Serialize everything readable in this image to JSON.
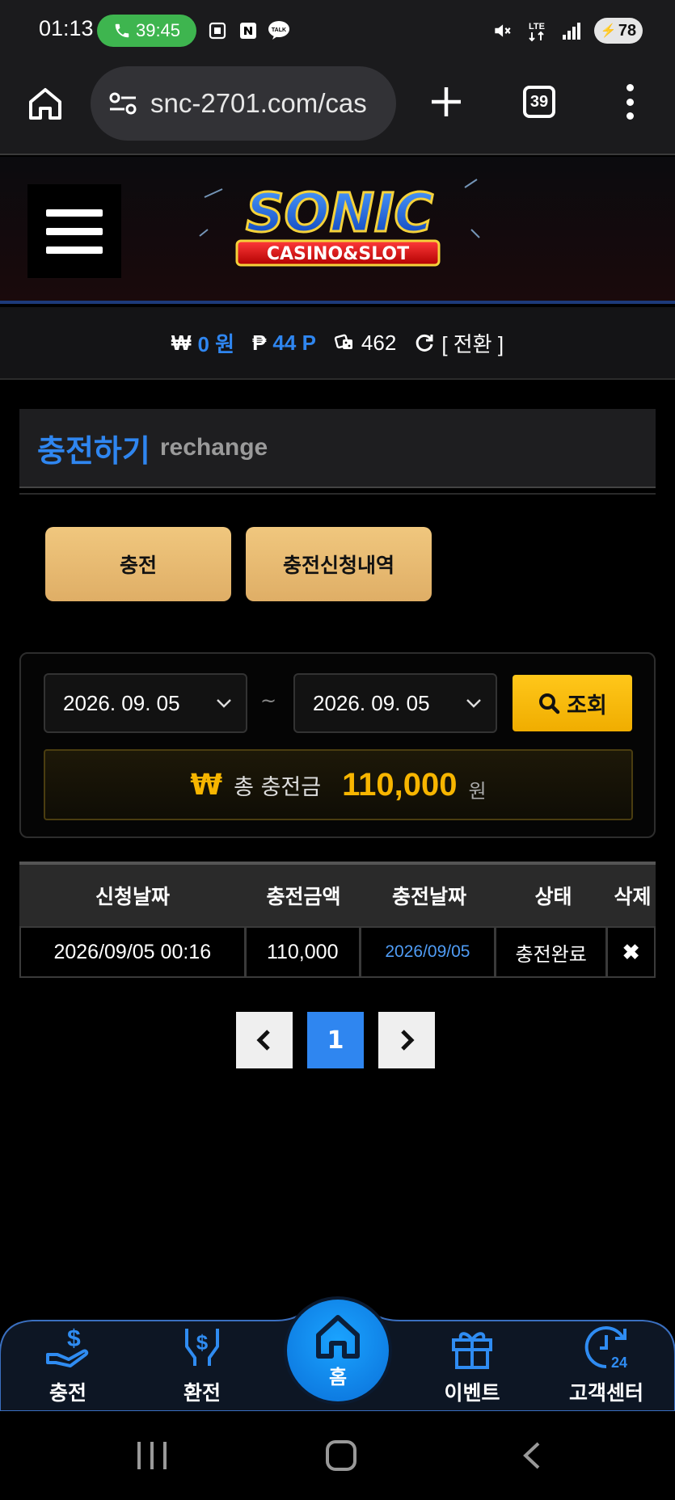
{
  "status_bar": {
    "time": "01:13",
    "call_duration": "39:45",
    "network": "LTE",
    "battery": "78"
  },
  "browser": {
    "url": "snc-2701.com/cas",
    "tab_count": "39"
  },
  "site": {
    "logo_title": "SONIC",
    "logo_subtitle": "CASINO&SLOT"
  },
  "balance": {
    "won_symbol": "₩",
    "money": "0 원",
    "point_symbol": "₱",
    "points": "44 P",
    "chips": "462",
    "switch_label": "[ 전환 ]"
  },
  "section": {
    "title_ko": "충전하기",
    "title_en": "rechange"
  },
  "tabs": [
    {
      "label": "충전"
    },
    {
      "label": "충전신청내역"
    }
  ],
  "filter": {
    "start_date": "2026. 09. 05",
    "separator": "~",
    "end_date": "2026. 09. 05",
    "search_label": "조회",
    "total_currency": "₩",
    "total_label": "총 충전금",
    "total_amount": "110,000",
    "total_unit": "원"
  },
  "table": {
    "headers": [
      "신청날짜",
      "충전금액",
      "충전날짜",
      "상태",
      "삭제"
    ],
    "rows": [
      {
        "request_date": "2026/09/05 00:16",
        "amount": "110,000",
        "charge_date": "2026/09/05",
        "status": "충전완료",
        "delete": "✖"
      }
    ]
  },
  "pagination": {
    "prev": "‹",
    "current": "1",
    "next": "›"
  },
  "bottom_nav": [
    {
      "label": "충전"
    },
    {
      "label": "환전"
    },
    {
      "label": "홈"
    },
    {
      "label": "이벤트"
    },
    {
      "label": "고객센터"
    }
  ],
  "colors": {
    "accent_blue": "#2f86f0",
    "gold_button": "#e6b56c",
    "search_yellow": "#f7b500"
  }
}
